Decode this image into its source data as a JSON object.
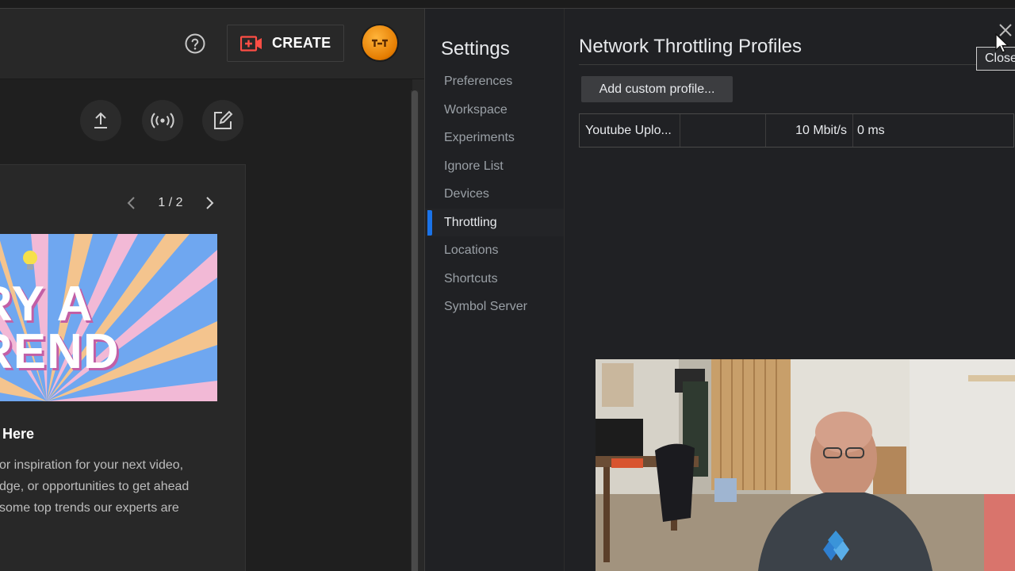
{
  "youtube": {
    "header": {
      "help_icon": "help-circle-icon",
      "create_label": "CREATE",
      "create_icon": "video-camera-plus-icon"
    },
    "actions": [
      "upload-icon",
      "live-broadcast-icon",
      "edit-post-icon"
    ],
    "card": {
      "pager": "1 / 2",
      "banner_lines": [
        "RY A",
        "REND"
      ],
      "title": "Here",
      "description": [
        "or inspiration for your next video,",
        "dge, or opportunities to get ahead",
        "some top trends our experts are"
      ]
    }
  },
  "settings": {
    "title": "Settings",
    "nav": [
      {
        "label": "Preferences",
        "active": false
      },
      {
        "label": "Workspace",
        "active": false
      },
      {
        "label": "Experiments",
        "active": false
      },
      {
        "label": "Ignore List",
        "active": false
      },
      {
        "label": "Devices",
        "active": false
      },
      {
        "label": "Throttling",
        "active": true
      },
      {
        "label": "Locations",
        "active": false
      },
      {
        "label": "Shortcuts",
        "active": false
      },
      {
        "label": "Symbol Server",
        "active": false
      }
    ]
  },
  "panel": {
    "title": "Network Throttling Profiles",
    "add_button": "Add custom profile...",
    "close_tooltip": "Close",
    "profiles": [
      {
        "name": "Youtube Uplo...",
        "download": "",
        "upload": "10 Mbit/s",
        "latency": "0 ms"
      }
    ]
  },
  "colors": {
    "accent": "#1a73e8",
    "create_icon_red": "#ff4e45",
    "devtools_bg": "#202124",
    "yt_bg": "#282828"
  }
}
